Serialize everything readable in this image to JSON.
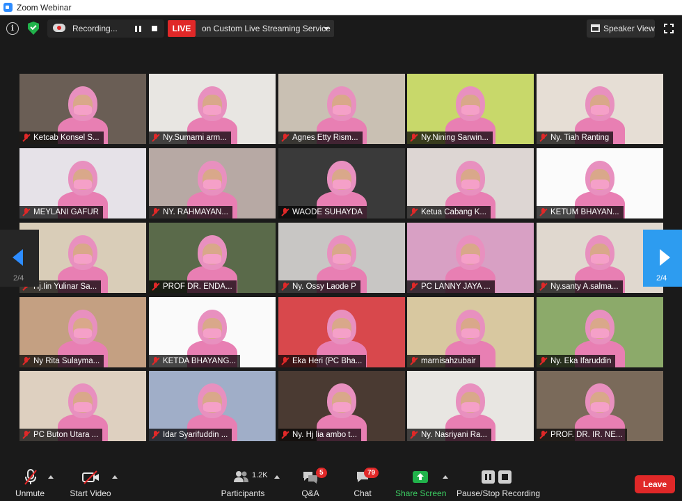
{
  "window": {
    "title": "Zoom Webinar"
  },
  "topbar": {
    "recording_label": "Recording...",
    "live_label": "LIVE",
    "stream_label": "on Custom Live Streaming Service",
    "speaker_view_label": "Speaker View"
  },
  "tiles": [
    {
      "name": "Ketcab Konsel S...",
      "bg": "#6a5e55"
    },
    {
      "name": "Ny.Sumarni arm...",
      "bg": "#e8e6e2"
    },
    {
      "name": "Agnes Etty Rism...",
      "bg": "#c9c0b3"
    },
    {
      "name": "Ny.Nining Sarwin...",
      "bg": "#c8d86a"
    },
    {
      "name": "Ny. Tiah Ranting",
      "bg": "#e6ded5"
    },
    {
      "name": "MEYLANI GAFUR",
      "bg": "#e6e2e8"
    },
    {
      "name": "NY. RAHMAYAN...",
      "bg": "#b7a9a4"
    },
    {
      "name": "WAODE SUHAYDA",
      "bg": "#3a3a3a"
    },
    {
      "name": "Ketua Cabang K...",
      "bg": "#ddd6d3"
    },
    {
      "name": "KETUM BHAYAN...",
      "bg": "#fbfbfb"
    },
    {
      "name": "Hj.Iin Yulinar Sa...",
      "bg": "#d9cdb8"
    },
    {
      "name": "PROF DR. ENDA...",
      "bg": "#5a6a4a"
    },
    {
      "name": "Ny. Ossy Laode P",
      "bg": "#c8c6c4"
    },
    {
      "name": "PC LANNY JAYA ...",
      "bg": "#d8a0c4"
    },
    {
      "name": "Ny.santy A.salma...",
      "bg": "#e0d8cf"
    },
    {
      "name": "Ny Rita Sulayma...",
      "bg": "#c4a082"
    },
    {
      "name": "KETDA BHAYANG...",
      "bg": "#fafafa"
    },
    {
      "name": "Eka Heri (PC Bha...",
      "bg": "#d8484c"
    },
    {
      "name": "marnisahzubair",
      "bg": "#d8c8a0"
    },
    {
      "name": "Ny. Eka Ifaruddin",
      "bg": "#8caa6a"
    },
    {
      "name": "PC Buton Utara ...",
      "bg": "#ded0c0"
    },
    {
      "name": "Idar Syarifuddin ...",
      "bg": "#a0aec8"
    },
    {
      "name": "Ny. Hj lia ambo t...",
      "bg": "#4a3a32"
    },
    {
      "name": "Ny. Nasriyani Ra...",
      "bg": "#e8e6e2"
    },
    {
      "name": "PROF. DR. IR. NE...",
      "bg": "#7a6a5a"
    }
  ],
  "nav": {
    "page_indicator": "2/4"
  },
  "toolbar": {
    "unmute": "Unmute",
    "start_video": "Start Video",
    "participants": "Participants",
    "participants_count": "1.2K",
    "qa": "Q&A",
    "qa_badge": "5",
    "chat": "Chat",
    "chat_badge": "79",
    "share_screen": "Share Screen",
    "pause_stop": "Pause/Stop Recording",
    "leave": "Leave"
  }
}
